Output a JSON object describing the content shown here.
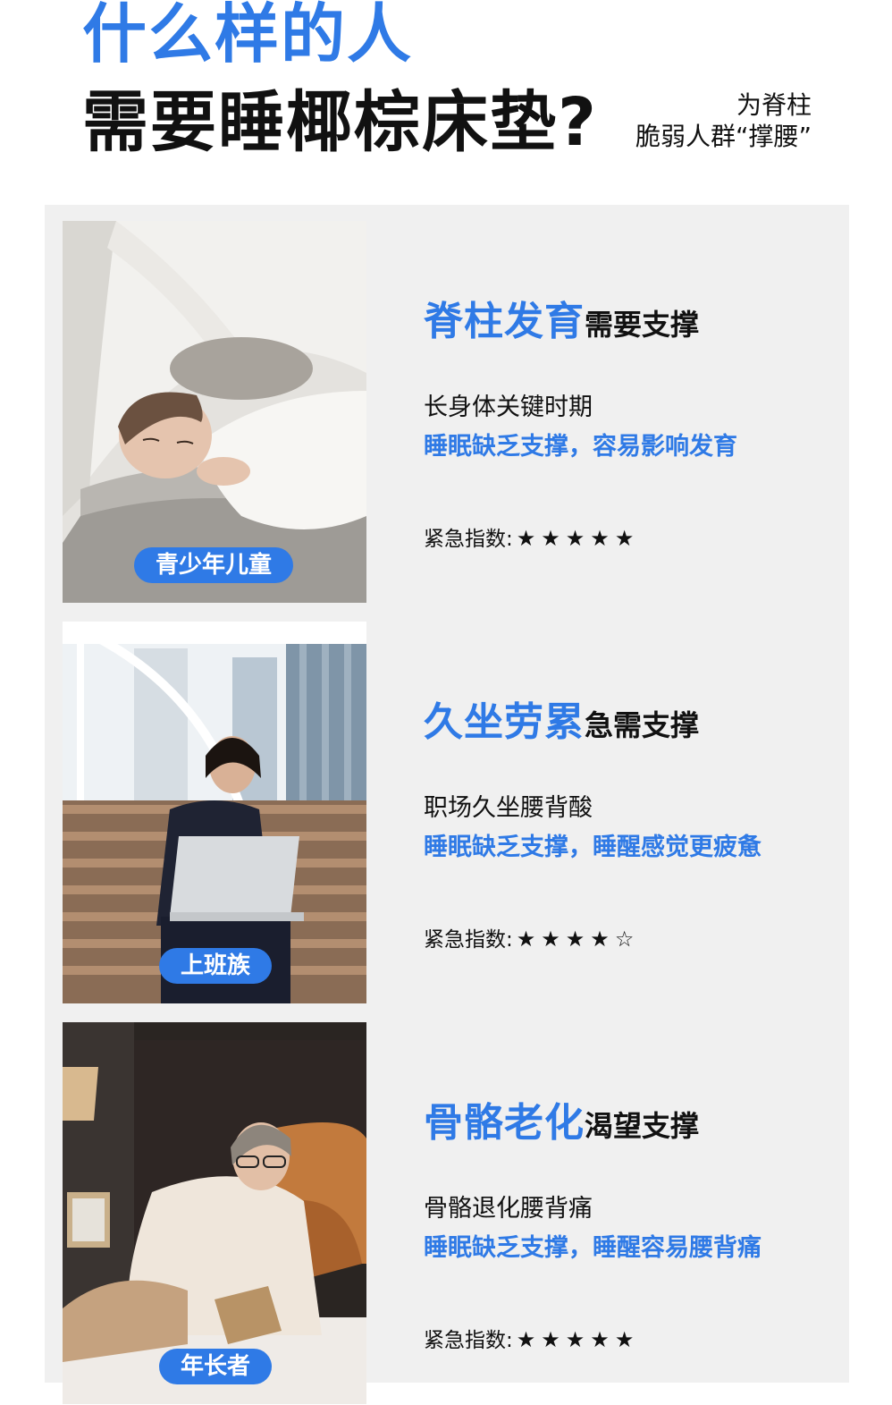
{
  "header": {
    "title_line1": "什么样的人",
    "title_line2": "需要睡椰棕床垫?",
    "subtitle_line1": "为脊柱",
    "subtitle_line2": "脆弱人群“撑腰”"
  },
  "colors": {
    "accent": "#2f7ae6",
    "panel_bg": "#f0f0f0",
    "text": "#111111"
  },
  "cards": [
    {
      "tag": "青少年儿童",
      "heading_main": "脊柱发育",
      "heading_sub": "需要支撑",
      "line1": "长身体关键时期",
      "line2": "睡眠缺乏支撑，容易影响发育",
      "rating_label": "紧急指数:",
      "stars": "★★★★★",
      "photo": "child-sleeping-in-tent-image"
    },
    {
      "tag": "上班族",
      "heading_main": "久坐劳累",
      "heading_sub": "急需支撑",
      "line1": "职场久坐腰背酸",
      "line2": "睡眠缺乏支撑，睡醒感觉更疲惫",
      "rating_label": "紧急指数:",
      "stars": "★★★★☆",
      "photo": "office-worker-with-laptop-on-stairs-image"
    },
    {
      "tag": "年长者",
      "heading_main": "骨骼老化",
      "heading_sub": "渴望支撑",
      "line1": "骨骼退化腰背痛",
      "line2": "睡眠缺乏支撑，睡醒容易腰背痛",
      "rating_label": "紧急指数:",
      "stars": "★★★★★",
      "photo": "elderly-woman-reading-in-bed-image"
    }
  ]
}
